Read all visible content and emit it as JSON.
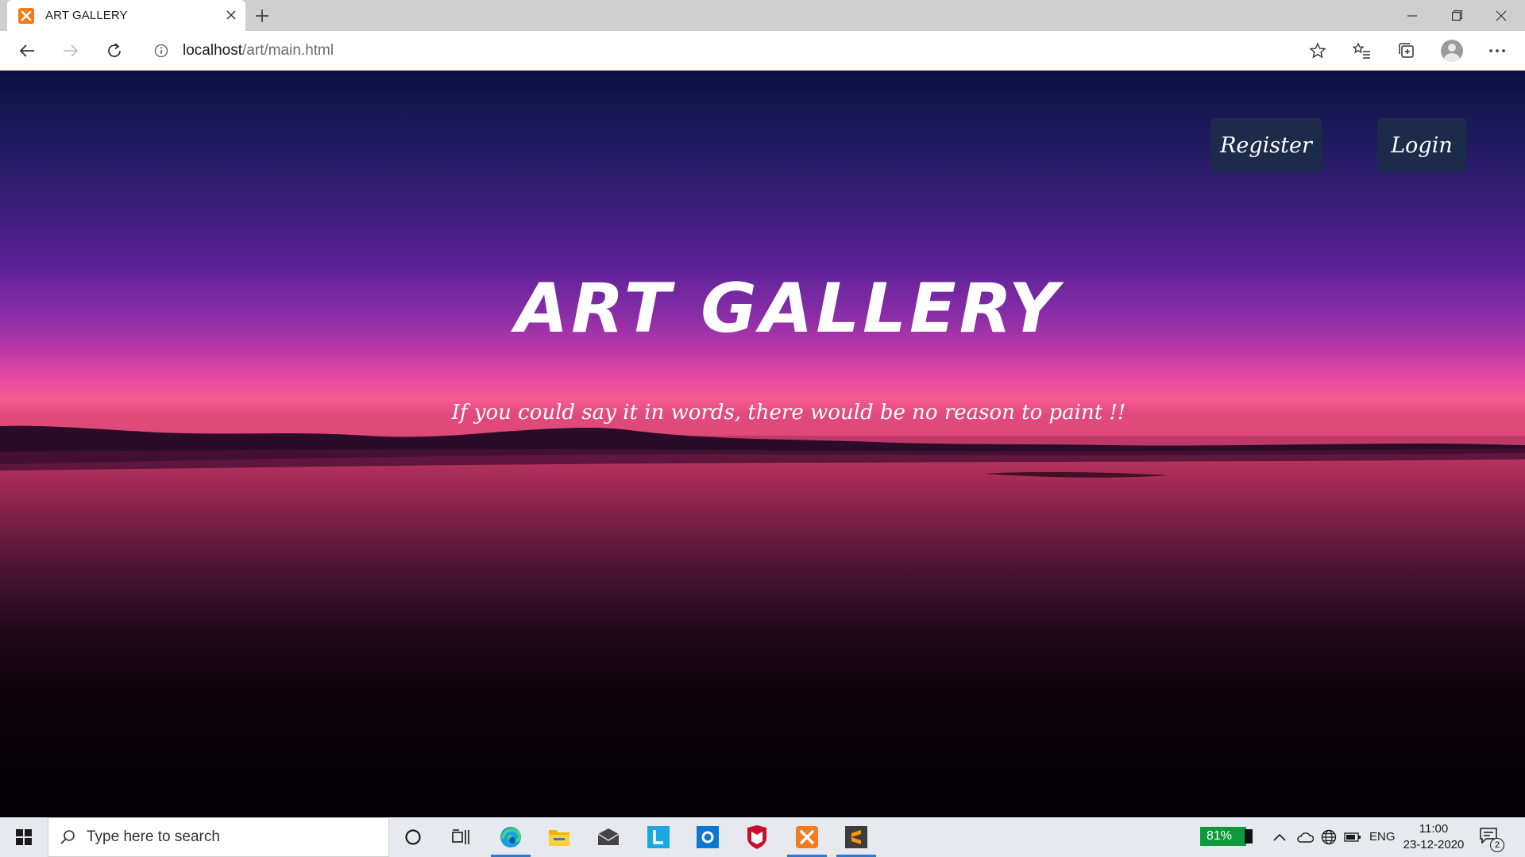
{
  "browser": {
    "tab_title": "ART GALLERY",
    "url_host": "localhost",
    "url_path": "/art/main.html"
  },
  "page": {
    "nav": {
      "register_label": "Register",
      "login_label": "Login"
    },
    "title": "ART GALLERY",
    "tagline": "If you could say it in words, there would be no reason to paint !!"
  },
  "taskbar": {
    "search_placeholder": "Type here to search",
    "battery_percent": "81%",
    "language": "ENG",
    "time": "11:00",
    "date": "23-12-2020",
    "notification_count": "2",
    "pinned_apps": [
      "microsoft-edge",
      "file-explorer",
      "mail",
      "l-app",
      "o-app",
      "mcafee",
      "xampp",
      "sublime-text"
    ]
  },
  "colors": {
    "button_bg": "#1c2b4a",
    "sky_top": "#0b1040",
    "sunset_pink": "#f85a93",
    "taskbar_bg": "#e6e9ee",
    "accent_blue": "#2b78d6"
  }
}
